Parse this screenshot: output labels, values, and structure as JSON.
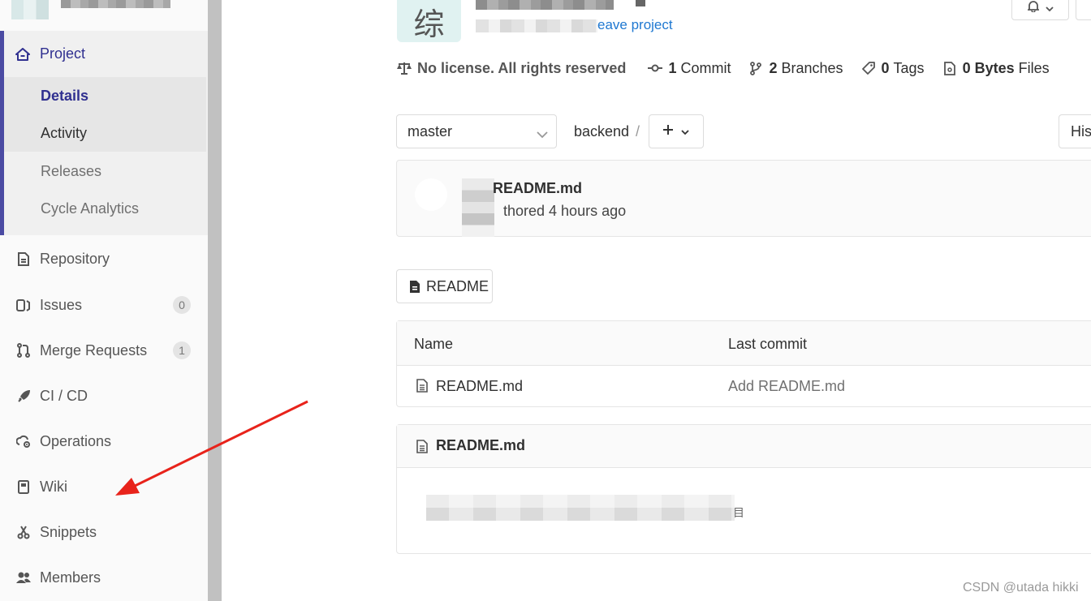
{
  "sidebar": {
    "project_label": "Project",
    "sub_items": [
      {
        "label": "Details"
      },
      {
        "label": "Activity"
      },
      {
        "label": "Releases"
      },
      {
        "label": "Cycle Analytics"
      }
    ],
    "items": [
      {
        "label": "Repository",
        "icon": "document-icon"
      },
      {
        "label": "Issues",
        "icon": "issues-icon",
        "badge": "0"
      },
      {
        "label": "Merge Requests",
        "icon": "merge-request-icon",
        "badge": "1"
      },
      {
        "label": "CI / CD",
        "icon": "rocket-icon"
      },
      {
        "label": "Operations",
        "icon": "cloud-gear-icon"
      },
      {
        "label": "Wiki",
        "icon": "book-icon"
      },
      {
        "label": "Snippets",
        "icon": "scissors-icon"
      },
      {
        "label": "Members",
        "icon": "users-icon"
      }
    ],
    "accent_color": "#4b4ba3"
  },
  "project": {
    "avatar_letter": "综",
    "leave_text": "eave project"
  },
  "stats": {
    "license": "No license. All rights reserved",
    "commits_count": "1",
    "commits_label": "Commit",
    "branches_count": "2",
    "branches_label": "Branches",
    "tags_count": "0",
    "tags_label": "Tags",
    "files_size": "0 Bytes",
    "files_label": "Files"
  },
  "repo_nav": {
    "branch": "master",
    "path": "backend",
    "separator": "/",
    "history_label": "Hist"
  },
  "last_commit": {
    "title": "README.md",
    "meta": "thored 4 hours ago"
  },
  "readme_button": "README",
  "file_tree": {
    "columns": [
      "Name",
      "Last commit"
    ],
    "rows": [
      {
        "name": "README.md",
        "commit": "Add README.md"
      }
    ]
  },
  "readme_blob": {
    "title": "README.md",
    "tail": "目"
  },
  "watermark": "CSDN @utada hikki",
  "annotation_arrow_color": "#e8231b"
}
